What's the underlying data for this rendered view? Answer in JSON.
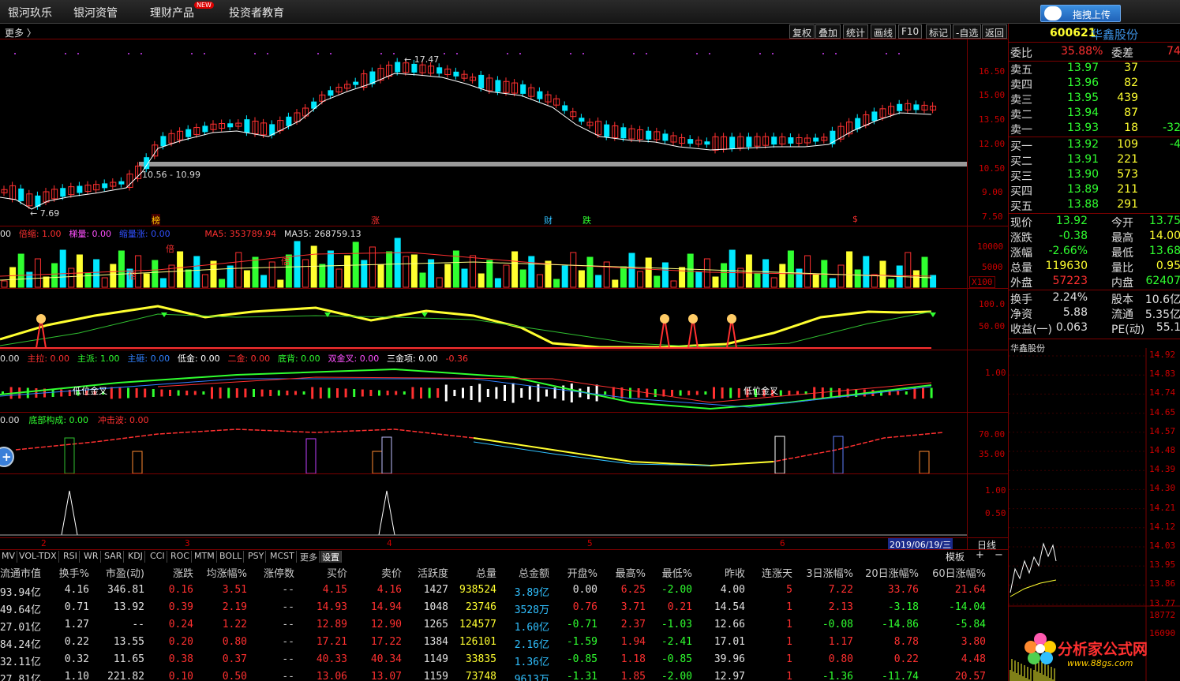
{
  "menu": [
    {
      "label": "银河玖乐"
    },
    {
      "label": "银河资管"
    },
    {
      "label": "理财产品",
      "badge": "NEW"
    },
    {
      "label": "投资者教育"
    }
  ],
  "upload_label": "拖拽上传",
  "toolbar": {
    "more": "更多 〉",
    "buttons": [
      "复权",
      "叠加",
      "统计",
      "画线",
      "F10",
      "标记",
      "-自选",
      "返回"
    ]
  },
  "price_panel": {
    "y_labels": [
      "16.50",
      "15.00",
      "13.50",
      "12.00",
      "10.50",
      "9.00",
      "7.50"
    ],
    "annotations": {
      "high": "17.47",
      "low": "7.69",
      "range": "10.56 - 10.99"
    },
    "event_marks": [
      "榜",
      "涨",
      "财",
      "跌",
      "$"
    ]
  },
  "volume_panel": {
    "legend": [
      {
        "text": "00",
        "color": "#e0e0e0"
      },
      {
        "text": "倍缩: 1.00",
        "color": "#ff3030"
      },
      {
        "text": "梯量: 0.00",
        "color": "#ff50ff"
      },
      {
        "text": "缩量涨: 0.00",
        "color": "#3050ff"
      },
      {
        "text": "MA5: 353789.94",
        "color": "#ff3030"
      },
      {
        "text": "MA35: 268759.13",
        "color": "#e0e0e0"
      }
    ],
    "y_labels": [
      "10000",
      "5000",
      "X100"
    ],
    "bei_mark": "倍"
  },
  "osc_panel": {
    "y_labels": [
      "100.0",
      "50.00"
    ]
  },
  "signal_panel": {
    "legend": [
      {
        "text": "0.00",
        "color": "#e0e0e0"
      },
      {
        "text": "主拉: 0.00",
        "color": "#ff3030"
      },
      {
        "text": "主派: 1.00",
        "color": "#30ff30"
      },
      {
        "text": "主砸: 0.00",
        "color": "#3080ff"
      },
      {
        "text": "低金: 0.00",
        "color": "#ffffff"
      },
      {
        "text": "二金: 0.00",
        "color": "#ff3030"
      },
      {
        "text": "底背: 0.00",
        "color": "#30ff30"
      },
      {
        "text": "双金叉: 0.00",
        "color": "#ff50ff"
      },
      {
        "text": "三金项: 0.00",
        "color": "#ffffff"
      },
      {
        "text": "-0.36",
        "color": "#ff3030"
      }
    ],
    "y_labels": [
      "1.00"
    ],
    "cross_label": "低位金叉"
  },
  "bottom_panel": {
    "legend": [
      {
        "text": "0.00",
        "color": "#e0e0e0"
      },
      {
        "text": "底部构成: 0.00",
        "color": "#30ff30"
      },
      {
        "text": "冲击波: 0.00",
        "color": "#ff3030"
      }
    ],
    "y_labels": [
      "70.00",
      "35.00"
    ]
  },
  "spike_panel": {
    "y_labels": [
      "1.00",
      "0.50"
    ]
  },
  "x_axis": {
    "labels": [
      "2",
      "3",
      "4",
      "5",
      "6"
    ],
    "date": "2019/06/19/三",
    "period": "日线"
  },
  "tabs": [
    "MV",
    "VOL-TDX",
    "RSI",
    "WR",
    "SAR",
    "KDJ",
    "CCI",
    "ROC",
    "MTM",
    "BOLL",
    "PSY",
    "MCST",
    "更多",
    "设置"
  ],
  "table": {
    "template_btn": "模板",
    "headers": [
      "流通市值",
      "换手%",
      "市盈(动)",
      "涨跌",
      "均涨幅%",
      "涨停数",
      "买价",
      "卖价",
      "活跃度",
      "总量",
      "总金额",
      "开盘%",
      "最高%",
      "最低%",
      "昨收",
      "连涨天",
      "3日涨幅%",
      "20日涨幅%",
      "60日涨幅%"
    ],
    "rows": [
      [
        "93.94亿",
        "4.16",
        "346.81",
        "0.16",
        "3.51",
        "--",
        "4.15",
        "4.16",
        "1427",
        "938524",
        "3.89亿",
        "0.00",
        "6.25",
        "-2.00",
        "4.00",
        "5",
        "7.22",
        "33.76",
        "21.64"
      ],
      [
        "49.64亿",
        "0.71",
        "13.92",
        "0.39",
        "2.19",
        "--",
        "14.93",
        "14.94",
        "1048",
        "23746",
        "3528万",
        "0.76",
        "3.71",
        "0.21",
        "14.54",
        "1",
        "2.13",
        "-3.18",
        "-14.04"
      ],
      [
        "27.01亿",
        "1.27",
        "--",
        "0.24",
        "1.22",
        "--",
        "12.89",
        "12.90",
        "1265",
        "124577",
        "1.60亿",
        "-0.71",
        "2.37",
        "-1.03",
        "12.66",
        "1",
        "-0.08",
        "-14.86",
        "-5.84"
      ],
      [
        "84.24亿",
        "0.22",
        "13.55",
        "0.20",
        "0.80",
        "--",
        "17.21",
        "17.22",
        "1384",
        "126101",
        "2.16亿",
        "-1.59",
        "1.94",
        "-2.41",
        "17.01",
        "1",
        "1.17",
        "8.78",
        "3.80"
      ],
      [
        "32.11亿",
        "0.32",
        "11.65",
        "0.38",
        "0.37",
        "--",
        "40.33",
        "40.34",
        "1149",
        "33835",
        "1.36亿",
        "-0.85",
        "1.18",
        "-0.85",
        "39.96",
        "1",
        "0.80",
        "0.22",
        "4.48"
      ],
      [
        "27.81亿",
        "1.10",
        "221.82",
        "0.10",
        "0.50",
        "--",
        "13.06",
        "13.07",
        "1159",
        "73748",
        "9613万",
        "-1.31",
        "1.85",
        "-2.00",
        "12.97",
        "1",
        "-1.36",
        "-11.74",
        "20.57"
      ]
    ]
  },
  "quote": {
    "code": "600621",
    "name": "华鑫股份",
    "weibi_label": "委比",
    "weibi": "35.88%",
    "weicha_label": "委差",
    "weicha": "74",
    "sells": [
      {
        "label": "卖五",
        "price": "13.97",
        "vol": "37",
        "chg": ""
      },
      {
        "label": "卖四",
        "price": "13.96",
        "vol": "82",
        "chg": ""
      },
      {
        "label": "卖三",
        "price": "13.95",
        "vol": "439",
        "chg": ""
      },
      {
        "label": "卖二",
        "price": "13.94",
        "vol": "87",
        "chg": ""
      },
      {
        "label": "卖一",
        "price": "13.93",
        "vol": "18",
        "chg": "-32"
      }
    ],
    "buys": [
      {
        "label": "买一",
        "price": "13.92",
        "vol": "109",
        "chg": "-4"
      },
      {
        "label": "买二",
        "price": "13.91",
        "vol": "221",
        "chg": ""
      },
      {
        "label": "买三",
        "price": "13.90",
        "vol": "573",
        "chg": ""
      },
      {
        "label": "买四",
        "price": "13.89",
        "vol": "211",
        "chg": ""
      },
      {
        "label": "买五",
        "price": "13.88",
        "vol": "291",
        "chg": ""
      }
    ],
    "stats": [
      {
        "l1": "现价",
        "v1": "13.92",
        "l2": "今开",
        "v2": "13.75",
        "c1": "#30ff30",
        "c2": "#30ff30"
      },
      {
        "l1": "涨跌",
        "v1": "-0.38",
        "l2": "最高",
        "v2": "14.00",
        "c1": "#30ff30",
        "c2": "#ffff30"
      },
      {
        "l1": "涨幅",
        "v1": "-2.66%",
        "l2": "最低",
        "v2": "13.68",
        "c1": "#30ff30",
        "c2": "#30ff30"
      },
      {
        "l1": "总量",
        "v1": "119630",
        "l2": "量比",
        "v2": "0.95",
        "c1": "#ffff30",
        "c2": "#ffff30"
      },
      {
        "l1": "外盘",
        "v1": "57223",
        "l2": "内盘",
        "v2": "62407",
        "c1": "#ff3030",
        "c2": "#30ff30"
      }
    ],
    "stats2": [
      {
        "l1": "换手",
        "v1": "2.24%",
        "l2": "股本",
        "v2": "10.6亿"
      },
      {
        "l1": "净资",
        "v1": "5.88",
        "l2": "流通",
        "v2": "5.35亿"
      },
      {
        "l1": "收益(一)",
        "v1": "0.063",
        "l2": "PE(动)",
        "v2": "55.1"
      }
    ],
    "mini_title": "华鑫股份",
    "mini_labels": [
      "14.92",
      "14.83",
      "14.74",
      "14.65",
      "14.57",
      "14.48",
      "14.39",
      "14.30",
      "14.21",
      "14.12",
      "14.03",
      "13.95",
      "13.86",
      "13.77"
    ],
    "mini_vol_labels": [
      "18772",
      "16090"
    ]
  },
  "watermark": {
    "cn": "分析家公式网",
    "url": "www.88gs.com"
  }
}
